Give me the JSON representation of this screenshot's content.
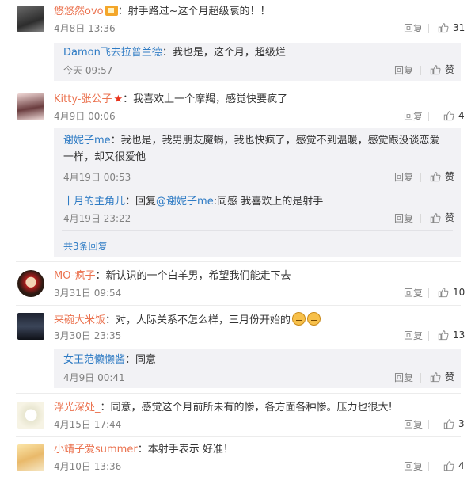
{
  "comments": [
    {
      "name": "悠悠然ovo",
      "text": "：射手路过~这个月超级衰的！！",
      "date": "4月8日 13:36",
      "reply": "回复",
      "likes": "31"
    },
    {
      "name": "Damon飞去拉普兰德",
      "text": "：我也是，这个月，超级烂",
      "date": "今天 09:57",
      "reply": "回复",
      "likes": "赞"
    },
    {
      "name": "Kitty-张公子",
      "text": "：我喜欢上一个摩羯，感觉快要疯了",
      "date": "4月9日 00:06",
      "reply": "回复",
      "likes": "4"
    },
    {
      "name": "谢妮子me",
      "text": "：我也是，我男朋友魔蝎，我也快疯了，感觉不到温暖，感觉跟没谈恋爱一样，却又很爱他",
      "date": "4月19日 00:53",
      "reply": "回复",
      "likes": "赞"
    },
    {
      "name": "十月的主角儿",
      "text": "：回复",
      "mention": "@谢妮子me",
      "text2": ":同感 我喜欢上的是射手",
      "date": "4月19日 23:22",
      "reply": "回复",
      "likes": "赞"
    },
    {
      "more": "共3条回复"
    },
    {
      "name": "MO-疯子",
      "text": "：新认识的一个白羊男，希望我们能走下去",
      "date": "3月31日 09:54",
      "reply": "回复",
      "likes": "10"
    },
    {
      "name": "来碗大米饭",
      "text": "：对，人际关系不怎么样，三月份开始的",
      "date": "3月30日 23:35",
      "reply": "回复",
      "likes": "13"
    },
    {
      "name": "女王范懒懒酱",
      "text": "：同意",
      "date": "4月9日 00:41",
      "reply": "回复",
      "likes": "赞"
    },
    {
      "name": "浮光深处_",
      "text": "：同意，感觉这个月前所未有的惨，各方面各种惨。压力也很大!",
      "date": "4月15日 17:44",
      "reply": "回复",
      "likes": "3"
    },
    {
      "name": "小靖子爱summer",
      "text": "：本射手表示 好准！",
      "date": "4月10日 13:36",
      "reply": "回复",
      "likes": "4"
    }
  ],
  "colors": {
    "name": "#eb7350",
    "sub_name": "#2e7bc4",
    "sub_bg": "#f2f2f5"
  }
}
